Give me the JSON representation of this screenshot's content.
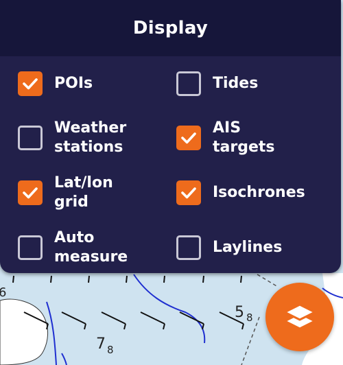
{
  "panel": {
    "title": "Display",
    "options": [
      {
        "label": "POIs",
        "checked": true
      },
      {
        "label": "Tides",
        "checked": false
      },
      {
        "label": "Weather\nstations",
        "checked": false
      },
      {
        "label": "AIS\ntargets",
        "checked": true
      },
      {
        "label": "Lat/lon\ngrid",
        "checked": true
      },
      {
        "label": "Isochrones",
        "checked": true
      },
      {
        "label": "Auto\nmeasure",
        "checked": false
      },
      {
        "label": "Laylines",
        "checked": false
      }
    ]
  },
  "map": {
    "soundings": [
      "6",
      "5",
      "8",
      "7",
      "8"
    ]
  },
  "fab": {
    "icon": "layers-icon"
  },
  "colors": {
    "accent": "#ee6b1c",
    "panel_bg": "#22204a",
    "header_bg": "#16163a",
    "water": "#cfe3f0",
    "land": "#ffffff",
    "depth_line": "#1f2fd0"
  }
}
